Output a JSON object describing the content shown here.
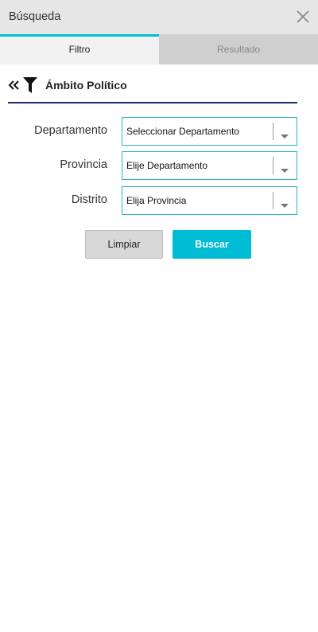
{
  "header": {
    "title": "Búsqueda"
  },
  "tabs": [
    {
      "label": "Filtro"
    },
    {
      "label": "Resultado"
    }
  ],
  "section": {
    "title": "Ámbito Político"
  },
  "form": {
    "fields": [
      {
        "label": "Departamento",
        "value": "Seleccionar Departamento"
      },
      {
        "label": "Provincia",
        "value": "Elije Departamento"
      },
      {
        "label": "Distrito",
        "value": "Elija Provincia"
      }
    ]
  },
  "buttons": {
    "clear_label": "Limpiar",
    "search_label": "Buscar"
  },
  "colors": {
    "accent": "#00bcd4",
    "divider": "#1a2a6c",
    "header_bg": "#e6e6e6"
  },
  "icons": [
    "close-icon",
    "double-chevron-left-icon",
    "filter-icon",
    "chevron-down-icon"
  ]
}
